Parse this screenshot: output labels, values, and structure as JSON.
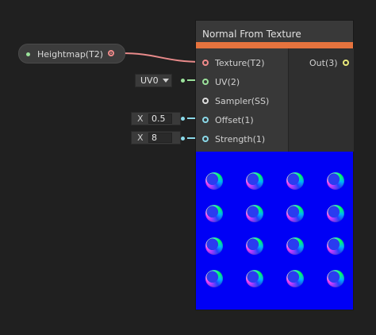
{
  "property_node": {
    "label": "Heightmap(T2)"
  },
  "node": {
    "title": "Normal From Texture",
    "accent_color": "#e5733e",
    "inputs": [
      {
        "label": "Texture(T2)",
        "color": "#f08a8a",
        "connected": true
      },
      {
        "label": "UV(2)",
        "color": "#9be29b",
        "connected": true
      },
      {
        "label": "Sampler(SS)",
        "color": "#dddddd",
        "connected": false
      },
      {
        "label": "Offset(1)",
        "color": "#8ad8e8",
        "connected": true
      },
      {
        "label": "Strength(1)",
        "color": "#8ad8e8",
        "connected": true
      }
    ],
    "output": {
      "label": "Out(3)",
      "color": "#e8e87a"
    }
  },
  "inline_fields": {
    "uv_channel": "UV0",
    "offset_axis": "X",
    "offset_value": "0.5",
    "strength_axis": "X",
    "strength_value": "8"
  },
  "preview": {
    "background": "#0000f5",
    "rows": 4,
    "cols": 4
  }
}
